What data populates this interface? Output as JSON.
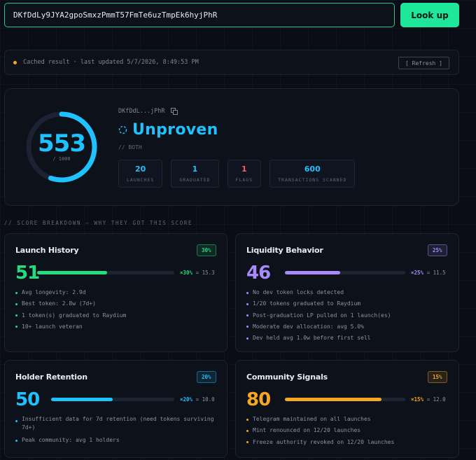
{
  "search": {
    "value": "DKfDdLy9JYA2gpoSmxzPmmT57FmTe6uzTmpEk6hyjPhR",
    "button_label": "Look up"
  },
  "status_bar": {
    "text": "Cached result · last updated 5/7/2026, 8:49:53 PM",
    "refresh_label": "[ Refresh ]",
    "dot_color": "#f5a623"
  },
  "score": {
    "value": "553",
    "max_label": "/ 1000",
    "fraction": 0.553,
    "short_address": "DKfDdL...jPhR",
    "verdict": "Unproven",
    "role": "// BOTH",
    "accent_color": "#1ec2ff",
    "stats": [
      {
        "value": "20",
        "label": "LAUNCHES",
        "color": "#1ec2ff"
      },
      {
        "value": "1",
        "label": "GRADUATED",
        "color": "#1ec2ff"
      },
      {
        "value": "1",
        "label": "FLAGS",
        "color": "#ff5a6a"
      },
      {
        "value": "600",
        "label": "TRANSACTIONS SCANNED",
        "color": "#1ec2ff"
      }
    ]
  },
  "section_heading": "// SCORE BREAKDOWN — WHY THEY GOT THIS SCORE",
  "categories": [
    {
      "title": "Launch History",
      "weight": "30%",
      "score": "51",
      "fraction": 0.51,
      "contribution_weight": "×30%",
      "contribution_result": "= 15.3",
      "color": "#23dd7e",
      "bullets": [
        "Avg longevity: 2.9d",
        "Best token: 2.8w (7d+)",
        "1 token(s) graduated to Raydium",
        "10+ launch veteran"
      ]
    },
    {
      "title": "Liquidity Behavior",
      "weight": "25%",
      "score": "46",
      "fraction": 0.46,
      "contribution_weight": "×25%",
      "contribution_result": "= 11.5",
      "color": "#a78bfa",
      "bullets": [
        "No dev token locks detected",
        "1/20 tokens graduated to Raydium",
        "Post-graduation LP pulled on 1 launch(es)",
        "Moderate dev allocation: avg 5.0%",
        "Dev held avg 1.0w before first sell"
      ]
    },
    {
      "title": "Holder Retention",
      "weight": "20%",
      "score": "50",
      "fraction": 0.5,
      "contribution_weight": "×20%",
      "contribution_result": "= 10.0",
      "color": "#1ec2ff",
      "bullets": [
        "Insufficient data for 7d retention (need tokens surviving 7d+)",
        "Peak community: avg 1 holders"
      ]
    },
    {
      "title": "Community Signals",
      "weight": "15%",
      "score": "80",
      "fraction": 0.8,
      "contribution_weight": "×15%",
      "contribution_result": "= 12.0",
      "color": "#f5a623",
      "bullets": [
        "Telegram maintained on all launches",
        "Mint renounced on 12/20 launches",
        "Freeze authority revoked on 12/20 launches"
      ]
    }
  ]
}
